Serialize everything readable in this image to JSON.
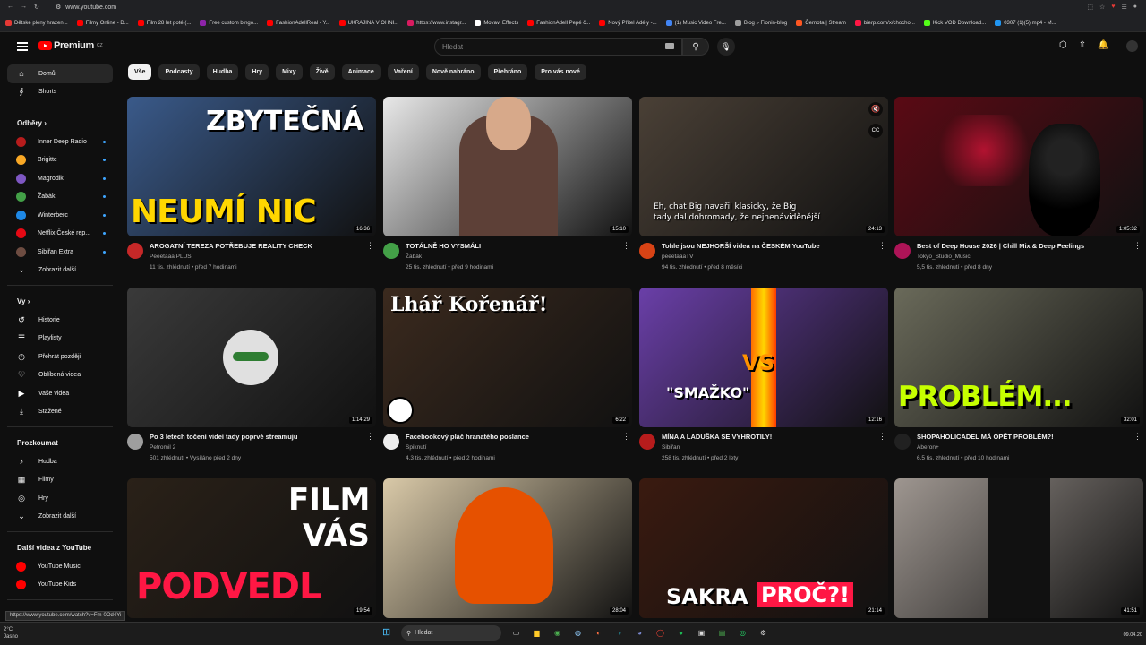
{
  "browser": {
    "url": "www.youtube.com",
    "bookmarks": [
      {
        "label": "Dětské pleny hrazen...",
        "color": "#e53935"
      },
      {
        "label": "Filmy Online - D...",
        "color": "#ff0000"
      },
      {
        "label": "Film 28 let poté (...",
        "color": "#ff0000"
      },
      {
        "label": "Free custom bingo...",
        "color": "#8e24aa"
      },
      {
        "label": "FashionAdellReal - Y...",
        "color": "#ff0000"
      },
      {
        "label": "UKRAJINA V OHNI...",
        "color": "#ff0000"
      },
      {
        "label": "https://www.instagr...",
        "color": "#d81b60"
      },
      {
        "label": "Movavi Effects",
        "color": "#ffffff"
      },
      {
        "label": "FashionAdell Pepé č...",
        "color": "#ff0000"
      },
      {
        "label": "Nový Přítel Adély -...",
        "color": "#ff0000"
      },
      {
        "label": "(1) Music Video Fre...",
        "color": "#4285f4"
      },
      {
        "label": "Blog » Fionin-blog",
        "color": "#9e9e9e"
      },
      {
        "label": "Černota | Stream",
        "color": "#ff5722"
      },
      {
        "label": "bierp.com/x/chocho...",
        "color": "#ff1744"
      },
      {
        "label": "Kick VOD Download...",
        "color": "#53fc18"
      },
      {
        "label": "0307 (1)(5).mp4 - M...",
        "color": "#2196f3"
      }
    ]
  },
  "header": {
    "logo_text": "Premium",
    "logo_sup": "CZ",
    "search_placeholder": "Hledat"
  },
  "sidebar": {
    "main": [
      {
        "label": "Domů",
        "icon": "home-icon",
        "glyph": "⌂"
      },
      {
        "label": "Shorts",
        "icon": "shorts-icon",
        "glyph": "∮"
      }
    ],
    "subs_heading": "Odběry ›",
    "subs": [
      {
        "label": "Inner Deep Radio",
        "color": "#b71c1c"
      },
      {
        "label": "Brigitte",
        "color": "#f9a825"
      },
      {
        "label": "Magrodik",
        "color": "#7e57c2"
      },
      {
        "label": "Žabák",
        "color": "#43a047"
      },
      {
        "label": "Winterberc",
        "color": "#1e88e5"
      },
      {
        "label": "Netflix České rep...",
        "color": "#e50914"
      },
      {
        "label": "Sibiřan Extra",
        "color": "#6d4c41"
      }
    ],
    "show_more": "Zobrazit další",
    "you_heading": "Vy ›",
    "you": [
      {
        "label": "Historie",
        "glyph": "↺"
      },
      {
        "label": "Playlisty",
        "glyph": "☰"
      },
      {
        "label": "Přehrát později",
        "glyph": "◷"
      },
      {
        "label": "Oblíbená videa",
        "glyph": "♡"
      },
      {
        "label": "Vaše videa",
        "glyph": "▶"
      },
      {
        "label": "Stažené",
        "glyph": "⤓"
      }
    ],
    "explore_heading": "Prozkoumat",
    "explore": [
      {
        "label": "Hudba",
        "glyph": "♪"
      },
      {
        "label": "Filmy",
        "glyph": "▦"
      },
      {
        "label": "Hry",
        "glyph": "◎"
      },
      {
        "label": "Zobrazit další",
        "glyph": "⌄"
      }
    ],
    "more_heading": "Další videa z YouTube",
    "more": [
      {
        "label": "YouTube Music"
      },
      {
        "label": "YouTube Kids"
      }
    ],
    "report_history": "Historie nahlašování"
  },
  "chips": [
    "Vše",
    "Podcasty",
    "Hudba",
    "Hry",
    "Mixy",
    "Živě",
    "Animace",
    "Vaření",
    "Nově nahráno",
    "Přehráno",
    "Pro vás nové"
  ],
  "videos": [
    {
      "title": "AROGATNÍ TEREZA POTŘEBUJE REALITY CHECK",
      "channel": "Peeetaaa PLUS",
      "stats": "11 tis. zhlédnutí • před 7 hodinami",
      "duration": "16:36",
      "bg": "#3a5a8a",
      "accent": "#ffd600",
      "text1": "ZBYTEČNÁ",
      "text2": "NEUMÍ NIC",
      "av": "#c62828"
    },
    {
      "title": "TOTÁLNĚ HO VYSMÁLI",
      "channel": "Žabák",
      "stats": "25 tis. zhlédnutí • před 9 hodinami",
      "duration": "15:10",
      "bg": "#e8e8e8",
      "accent": "#5d4037",
      "text1": "",
      "text2": "",
      "av": "#43a047"
    },
    {
      "title": "Tohle jsou NEJHORŠÍ videa na ČESKÉM YouTube",
      "channel": "peeetaaaTV",
      "stats": "94 tis. zhlédnutí • před 8 měsíci",
      "duration": "24:13",
      "bg": "#4a4036",
      "accent": "#ffffff",
      "text1": "Eh, chat Big navařil klasicky, že Big",
      "text2": "tady dal dohromady, že nejnenáviděnější",
      "av": "#d84315"
    },
    {
      "title": "Best of Deep House 2026 | Chill Mix & Deep Feelings",
      "channel": "Tokyo_Studio_Music",
      "stats": "5,5 tis. zhlédnutí • před 8 dny",
      "duration": "1:05:32",
      "bg": "#5a0a14",
      "accent": "#ff1744",
      "text1": "",
      "text2": "",
      "av": "#ad1457"
    },
    {
      "title": "Po 3 letech točení videí tady poprvé streamuju",
      "channel": "Petromil 2",
      "stats": "501 zhlédnutí • Vysíláno před 2 dny",
      "duration": "1:14:29",
      "bg": "#3a3a3a",
      "accent": "#ffffff",
      "text1": "",
      "text2": "",
      "av": "#9e9e9e"
    },
    {
      "title": "Facebookový pláč hranatého poslance",
      "channel": "Spiknutí",
      "stats": "4,3 tis. zhlédnutí • před 2 hodinami",
      "duration": "6:22",
      "bg": "#3b2a1e",
      "accent": "#ffffff",
      "text1": "Lhář Kořenář!",
      "text2": "",
      "av": "#eeeeee"
    },
    {
      "title": "MÍNA A LADUŠKA SE VYHROTILY!",
      "channel": "Sibiřan",
      "stats": "258 tis. zhlédnutí • před 2 lety",
      "duration": "12:16",
      "bg": "#6a3fa8",
      "accent": "#ff6d00",
      "text1": "VS",
      "text2": "\"SMAŽKO\"",
      "av": "#b71c1c"
    },
    {
      "title": "SHOPAHOLICADEL MÁ OPĚT PROBLÉM?!",
      "channel": "Aberon+",
      "stats": "6,5 tis. zhlédnutí • před 10 hodinami",
      "duration": "32:01",
      "bg": "#6a6a5a",
      "accent": "#c6ff00",
      "text1": "PROBLÉM...",
      "text2": "",
      "av": "#212121"
    },
    {
      "title": "",
      "channel": "",
      "stats": "",
      "duration": "19:54",
      "bg": "#2a2118",
      "accent": "#ff1744",
      "text1": "FILM",
      "text2": "VÁS",
      "av": "#000000"
    },
    {
      "title": "",
      "channel": "",
      "stats": "",
      "duration": "28:04",
      "bg": "#d9c9a8",
      "accent": "#e65100",
      "text1": "",
      "text2": "",
      "av": "#000000"
    },
    {
      "title": "",
      "channel": "",
      "stats": "",
      "duration": "21:14",
      "bg": "#3a1a10",
      "accent": "#ff1744",
      "text1": "SAKRA",
      "text2": "PROČ?!",
      "av": "#000000"
    },
    {
      "title": "",
      "channel": "",
      "stats": "",
      "duration": "41:51",
      "bg": "#9e9690",
      "accent": "#ffffff",
      "text1": "",
      "text2": "",
      "av": "#000000"
    }
  ],
  "film_text3": "PODVEDL",
  "status_url": "https://www.youtube.com/watch?v=Fm-0Od4Yi",
  "taskbar": {
    "weather_temp": "2°C",
    "weather_text": "Jasno",
    "search": "Hledat",
    "time": "09.04.20"
  }
}
